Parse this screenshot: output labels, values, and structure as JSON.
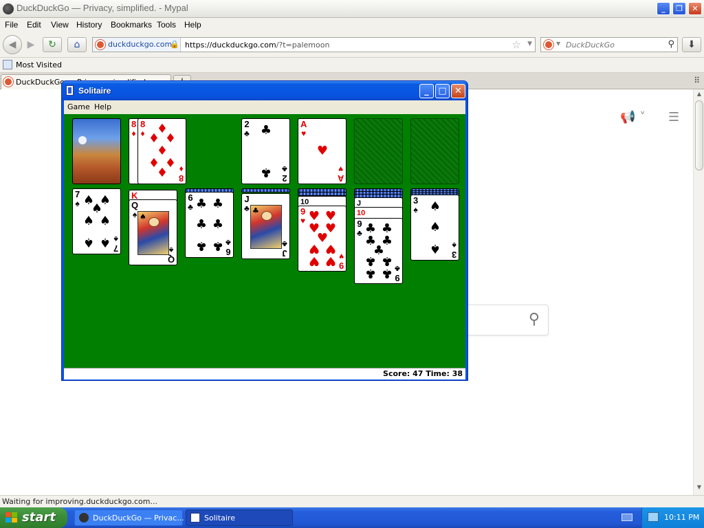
{
  "browser": {
    "title": "DuckDuckGo — Privacy, simplified. - Mypal",
    "menu": [
      "File",
      "Edit",
      "View",
      "History",
      "Bookmarks",
      "Tools",
      "Help"
    ],
    "site_identity": "duckduckgo.com",
    "url_host": "https://duckduckgo.com",
    "url_path": "/?t=palemoon",
    "search_placeholder": "DuckDuckGo",
    "bookmark": "Most Visited",
    "tab_label": "DuckDuckGo — Privacy, simplified.",
    "new_tab_symbol": "+",
    "status_text": "Waiting for improving.duckduckgo.com..."
  },
  "solitaire": {
    "title": "Solitaire",
    "menu": [
      "Game",
      "Help"
    ],
    "score_label": "Score: 47 Time: 38",
    "score": 47,
    "time": 38,
    "colors": {
      "felt": "#007f00",
      "red_suit": "#e00000",
      "title_blue": "#0a53e3"
    },
    "waste_back_card": "8 of diamonds",
    "waste": {
      "rank": "8",
      "suit": "♦",
      "color": "red"
    },
    "foundations": [
      {
        "rank": "2",
        "suit": "♣",
        "color": "black"
      },
      {
        "rank": "A",
        "suit": "♥",
        "color": "red"
      },
      {
        "empty": true
      },
      {
        "empty": true
      }
    ],
    "tableau": [
      {
        "hidden": 0,
        "top": {
          "rank": "7",
          "suit": "♠",
          "color": "black"
        }
      },
      {
        "hidden": 0,
        "peek": {
          "rank": "K",
          "suit": "♠",
          "color": "black"
        },
        "top": {
          "rank": "Q",
          "suit": "♠",
          "color": "black"
        }
      },
      {
        "hidden": 1,
        "top": {
          "rank": "6",
          "suit": "♣",
          "color": "black"
        }
      },
      {
        "hidden": 1,
        "top": {
          "rank": "J",
          "suit": "♣",
          "color": "black"
        }
      },
      {
        "hidden": 2,
        "peek": {
          "rank": "10",
          "suit": "♠",
          "color": "black"
        },
        "top": {
          "rank": "9",
          "suit": "♥",
          "color": "red"
        }
      },
      {
        "hidden": 3,
        "peek": {
          "rank": "J",
          "suit": "♣",
          "color": "black"
        },
        "peek2": {
          "rank": "10",
          "suit": "♥",
          "color": "red"
        },
        "top": {
          "rank": "9",
          "suit": "♣",
          "color": "black"
        }
      },
      {
        "hidden": 3,
        "top": {
          "rank": "3",
          "suit": "♠",
          "color": "black"
        }
      }
    ]
  },
  "taskbar": {
    "start": "start",
    "items": [
      "DuckDuckGo — Privac...",
      "Solitaire"
    ],
    "clock": "10:11 PM"
  }
}
